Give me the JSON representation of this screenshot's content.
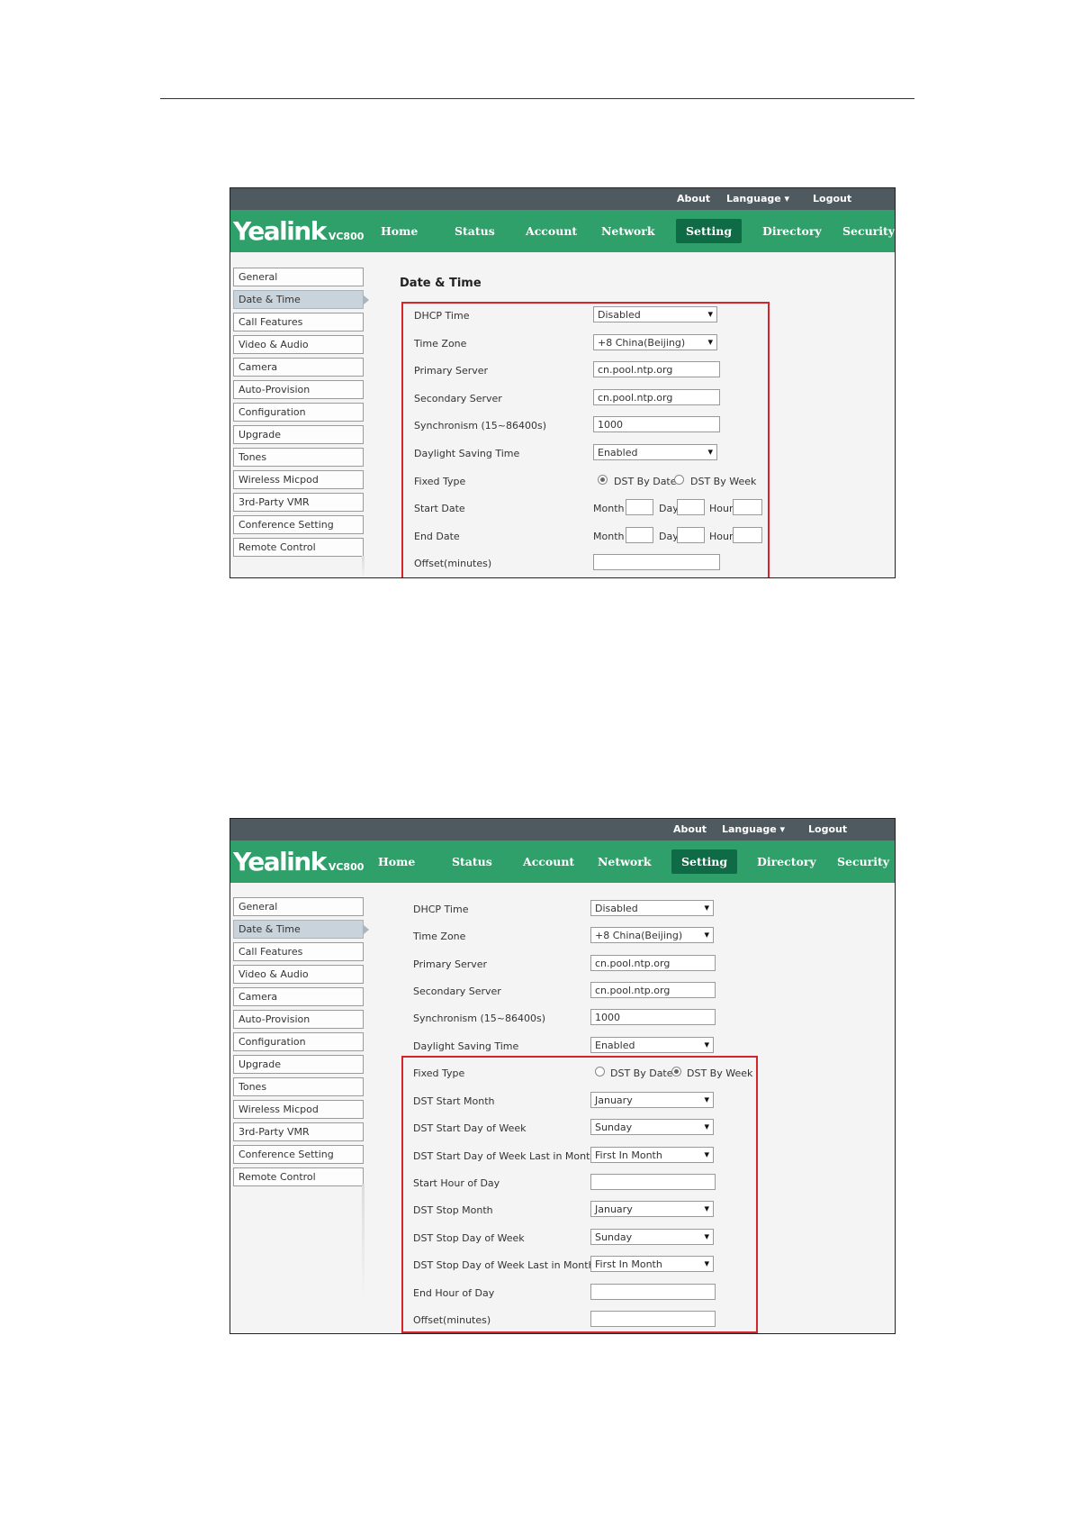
{
  "header": {
    "about": "About",
    "language": "Language ▾",
    "logout": "Logout"
  },
  "brand": {
    "logo": "Yealink",
    "model": "VC800"
  },
  "nav_tabs": [
    "Home",
    "Status",
    "Account",
    "Network",
    "Setting",
    "Directory",
    "Security"
  ],
  "nav_active": "Setting",
  "sidebar": [
    "General",
    "Date & Time",
    "Call Features",
    "Video & Audio",
    "Camera",
    "Auto-Provision",
    "Configuration",
    "Upgrade",
    "Tones",
    "Wireless Micpod",
    "3rd-Party VMR",
    "Conference Setting",
    "Remote Control"
  ],
  "sidebar_active": "Date & Time",
  "shot1": {
    "title": "Date & Time",
    "dhcp_time_label": "DHCP Time",
    "dhcp_time_value": "Disabled",
    "time_zone_label": "Time Zone",
    "time_zone_value": "+8 China(Beijing)",
    "primary_server_label": "Primary Server",
    "primary_server_value": "cn.pool.ntp.org",
    "secondary_server_label": "Secondary Server",
    "secondary_server_value": "cn.pool.ntp.org",
    "sync_label": "Synchronism (15~86400s)",
    "sync_value": "1000",
    "dst_label": "Daylight Saving Time",
    "dst_value": "Enabled",
    "fixed_type_label": "Fixed Type",
    "dst_by_date": "DST By Date",
    "dst_by_week": "DST By Week",
    "fixed_type_selected": "DST By Date",
    "start_date_label": "Start Date",
    "end_date_label": "End Date",
    "month": "Month",
    "day": "Day",
    "hour": "Hour",
    "offset_label": "Offset(minutes)"
  },
  "shot2": {
    "dhcp_time_label": "DHCP Time",
    "dhcp_time_value": "Disabled",
    "time_zone_label": "Time Zone",
    "time_zone_value": "+8 China(Beijing)",
    "primary_server_label": "Primary Server",
    "primary_server_value": "cn.pool.ntp.org",
    "secondary_server_label": "Secondary Server",
    "secondary_server_value": "cn.pool.ntp.org",
    "sync_label": "Synchronism (15~86400s)",
    "sync_value": "1000",
    "dst_label": "Daylight Saving Time",
    "dst_value": "Enabled",
    "fixed_type_label": "Fixed Type",
    "dst_by_date": "DST By Date",
    "dst_by_week": "DST By Week",
    "fixed_type_selected": "DST By Week",
    "start_month_label": "DST Start Month",
    "start_month_value": "January",
    "start_dow_label": "DST Start Day of Week",
    "start_dow_value": "Sunday",
    "start_dow_last_label": "DST Start Day of Week Last in Month",
    "start_dow_last_value": "First In Month",
    "start_hour_label": "Start Hour of Day",
    "stop_month_label": "DST Stop Month",
    "stop_month_value": "January",
    "stop_dow_label": "DST Stop Day of Week",
    "stop_dow_value": "Sunday",
    "stop_dow_last_label": "DST Stop Day of Week Last in Month",
    "stop_dow_last_value": "First In Month",
    "end_hour_label": "End Hour of Day",
    "offset_label": "Offset(minutes)"
  }
}
